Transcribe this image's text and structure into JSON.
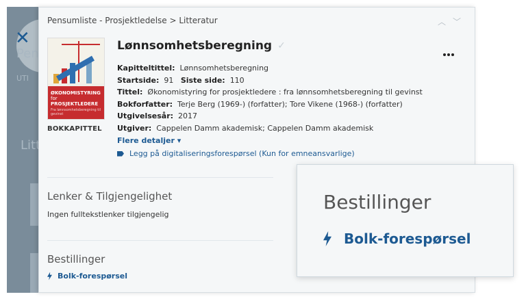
{
  "breadcrumb": "Pensumliste - Prosjektledelse > Litteratur",
  "record": {
    "title": "Lønnsomhetsberegning",
    "type_label": "BOKKAPITTEL",
    "cover": {
      "title_line1": "ØKONOMISTYRING",
      "title_line2": "for",
      "title_line3": "PROSJEKTLEDERE",
      "subtitle": "Fra lønnsomhetsberegning til gevinst"
    },
    "fields": [
      {
        "label": "Kapitteltittel:",
        "value": "Lønnsomhetsberegning"
      },
      {
        "label": "Startside:",
        "value": "91",
        "label2": "Siste side:",
        "value2": "110"
      },
      {
        "label": "Tittel:",
        "value": "Økonomistyring for prosjektledere : fra lønnsomhetsberegning til gevinst"
      },
      {
        "label": "Bokforfatter:",
        "value": "Terje Berg (1969-) (forfatter); Tore Vikene (1968-) (forfatter)"
      },
      {
        "label": "Utgivelsesår:",
        "value": "2017"
      },
      {
        "label": "Utgiver:",
        "value": "Cappelen Damm akademisk; Cappelen Damm akademisk"
      }
    ],
    "more_details": "Flere detaljer ▾",
    "digitization_link": "Legg på digitaliseringsforespørsel (Kun for emneansvarlige)"
  },
  "links_section": {
    "title": "Lenker & Tilgjengelighet",
    "text": "Ingen fulltekstlenker tilgjengelig"
  },
  "orders_section": {
    "title": "Bestillinger",
    "link": "Bolk-forespørsel"
  },
  "callout": {
    "title": "Bestillinger",
    "link": "Bolk-forespørsel"
  },
  "background": {
    "partial_texts": [
      "Pens",
      "UTI",
      "Litt"
    ]
  },
  "colors": {
    "link": "#1d5a92",
    "cover_red": "#c62c2f",
    "panel_bg": "#f5f7f8"
  }
}
